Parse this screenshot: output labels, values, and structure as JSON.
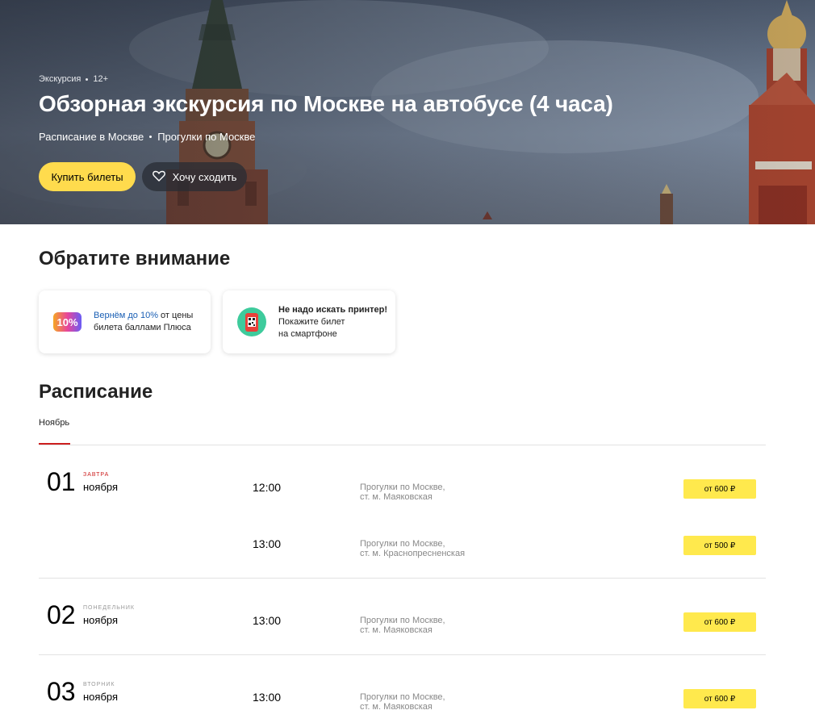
{
  "hero": {
    "category": "Экскурсия",
    "age": "12+",
    "title": "Обзорная экскурсия по Москве на автобусе (4 часа)",
    "links": [
      "Расписание в Москве",
      "Прогулки по Москве"
    ],
    "buy_label": "Купить билеты",
    "want_label": "Хочу сходить"
  },
  "attention": {
    "heading": "Обратите внимание",
    "cards": [
      {
        "badge": "10%",
        "icon": "plus-cashback-icon",
        "highlight": "Вернём до 10%",
        "rest1": " от цены",
        "line2": "билета баллами Плюса"
      },
      {
        "icon": "phone-ticket-icon",
        "title": "Не надо искать принтер!",
        "line2": "Покажите билет",
        "line3": "на смартфоне"
      }
    ]
  },
  "schedule": {
    "heading": "Расписание",
    "month_tab": "Ноябрь",
    "days": [
      {
        "num": "01",
        "tag": "завтра",
        "month": "ноября",
        "sessions": [
          {
            "time": "12:00",
            "place1": "Прогулки по Москве,",
            "place2": "ст. м. Маяковская",
            "price": "от 600 ₽"
          },
          {
            "time": "13:00",
            "place1": "Прогулки по Москве,",
            "place2": "ст. м. Краснопресненская",
            "price": "от 500 ₽"
          }
        ]
      },
      {
        "num": "02",
        "tag": "понедельник",
        "month": "ноября",
        "sessions": [
          {
            "time": "13:00",
            "place1": "Прогулки по Москве,",
            "place2": "ст. м. Маяковская",
            "price": "от 600 ₽"
          }
        ]
      },
      {
        "num": "03",
        "tag": "вторник",
        "month": "ноября",
        "sessions": [
          {
            "time": "13:00",
            "place1": "Прогулки по Москве,",
            "place2": "ст. м. Маяковская",
            "price": "от 600 ₽"
          }
        ]
      }
    ]
  },
  "colors": {
    "accent_yellow": "#ffdb4d",
    "price_yellow": "#ffe94d",
    "tab_red": "#cc1f1f",
    "link_blue": "#1a5fb4"
  }
}
